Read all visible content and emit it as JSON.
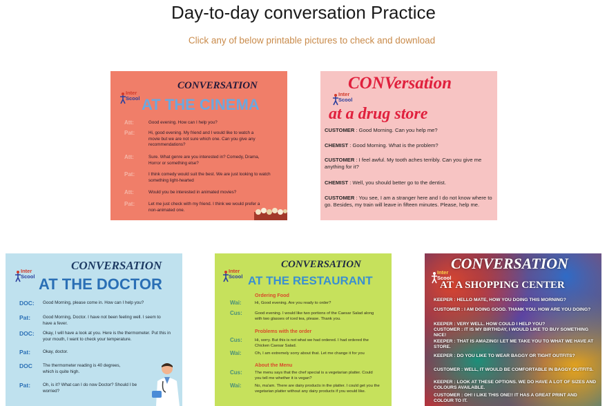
{
  "page": {
    "title": "Day-to-day conversation Practice",
    "subtitle": "Click any of below printable pictures to check and download"
  },
  "logo": {
    "line1": "Inter",
    "line2": "Scool"
  },
  "colors": {
    "cinema_bg": "#f07e69",
    "drug_bg": "#f7c4c3",
    "doctor_bg": "#bfe1ee",
    "restaurant_bg": "#c6e15c",
    "accent_text": "#c98b4b"
  },
  "cards": {
    "cinema": {
      "heading": "CONVERSATION",
      "place": "AT THE CINEMA",
      "lines": [
        {
          "speaker": "Att:",
          "text": "Good evening. How can I help you?"
        },
        {
          "speaker": "Pat:",
          "text": "Hi, good evening. My friend and I would like to watch a movie but we are not sure which one. Can you give any recommendations?"
        },
        {
          "speaker": "Att:",
          "text": "Sure. What genre are you interested in? Comedy, Drama, Horror or something else?"
        },
        {
          "speaker": "Pat:",
          "text": "I think comedy would suit the best. We are just looking to watch something light-hearted"
        },
        {
          "speaker": "Att:",
          "text": "Would you be interested in animated movies?"
        },
        {
          "speaker": "Pat:",
          "text": "Let me just check with my friend. I think we would prefer a non-animated one."
        }
      ]
    },
    "drug": {
      "heading": "CONVersation",
      "place": "at a drug store",
      "lines": [
        {
          "speaker": "CUSTOMER",
          "text": " : Good Morning. Can you help me?"
        },
        {
          "speaker": "CHEMIST",
          "text": " : Good Morning. What is the problem?"
        },
        {
          "speaker": "CUSTOMER",
          "text": " : I feel awful. My tooth aches terribly. Can you give me anything for it?"
        },
        {
          "speaker": "CHEMIST",
          "text": " : Well, you should better go to the dentist."
        },
        {
          "speaker": "CUSTOMER",
          "text": " : You see, I am a stranger here and I do not know where to go. Besides, my train will leave in fifteen minutes. Please, help me."
        }
      ]
    },
    "doctor": {
      "heading": "CONVERSATION",
      "place": "AT THE DOCTOR",
      "lines": [
        {
          "speaker": "DOC:",
          "text": "Good Morning, please come in. How can I help you?"
        },
        {
          "speaker": "Pat:",
          "text": "Good Morning, Doctor. I have not been feeling well. I seem to have a fever."
        },
        {
          "speaker": "DOC:",
          "text": "Okay, I will have a look at you. Here is the thermometer. Put this in your mouth, I want to check your temperature."
        },
        {
          "speaker": "Pat:",
          "text": "Okay, doctor."
        },
        {
          "speaker": "DOC",
          "text": "The thermometer reading is 40 degrees, which is quite high."
        },
        {
          "speaker": "Pat:",
          "text": "Oh, is it? What can I do now Doctor? Should I be worried?"
        }
      ]
    },
    "restaurant": {
      "heading": "CONVERSATION",
      "place": "AT THE RESTAURANT",
      "sections": [
        "Ordering Food",
        "Problems with the order",
        "About the Menu"
      ],
      "lines": [
        {
          "speaker": "Wai:",
          "text": "Hi, Good evening. Are you ready to order?"
        },
        {
          "speaker": "Cus:",
          "text": "Good evening. I would like two portions of the Caesar Salad along with two glasses of iced tea, please. Thank you."
        },
        {
          "speaker": "Cus:",
          "text": "Hi, sorry. But this is not what we had ordered. I had ordered the Chicken Caesar Salad."
        },
        {
          "speaker": "Wai:",
          "text": "Oh, I am extremely sorry about that. Let me change it for you"
        },
        {
          "speaker": "Cus:",
          "text": "The menu says that the chef special is a vegetarian platter. Could you tell me whether it is vegan?"
        },
        {
          "speaker": "Wai:",
          "text": "No, ma'am. There are dairy products in the platter. I could get you the vegetarian platter without any dairy products if you would like."
        }
      ]
    },
    "shopping": {
      "heading": "CONVERSATION",
      "place": "AT A SHOPPING CENTER",
      "lines": [
        "KEEPER : HELLO MATE, HOW YOU DOING THIS MORNING?",
        "CUSTOMER : I AM DOING GOOD. THANK YOU. HOW ARE YOU DOING?",
        "KEEPER : VERY WELL. HOW COULD I HELP YOU?",
        "CUSTOMER : IT IS MY BIRTHDAY, I WOULD LIKE TO BUY SOMETHING NICE!",
        "KEEPER : THAT IS AMAZING! LET ME TAKE YOU TO WHAT WE HAVE AT STORE.",
        "KEEPER : DO YOU LIKE TO WEAR BAGGY OR TIGHT OUTFITS?",
        "CUSTOMER : WELL, IT WOULD BE COMFORTABLE IN BAGGY OUTFITS.",
        "KEEPER : LOOK AT THESE OPTIONS. WE DO HAVE A LOT OF SIZES AND COLOURS AVAILABLE.",
        "CUSTOMER : OH! I LIKE THIS ONE!! IT HAS A GREAT PRINT AND COLOUR TO IT."
      ]
    }
  }
}
